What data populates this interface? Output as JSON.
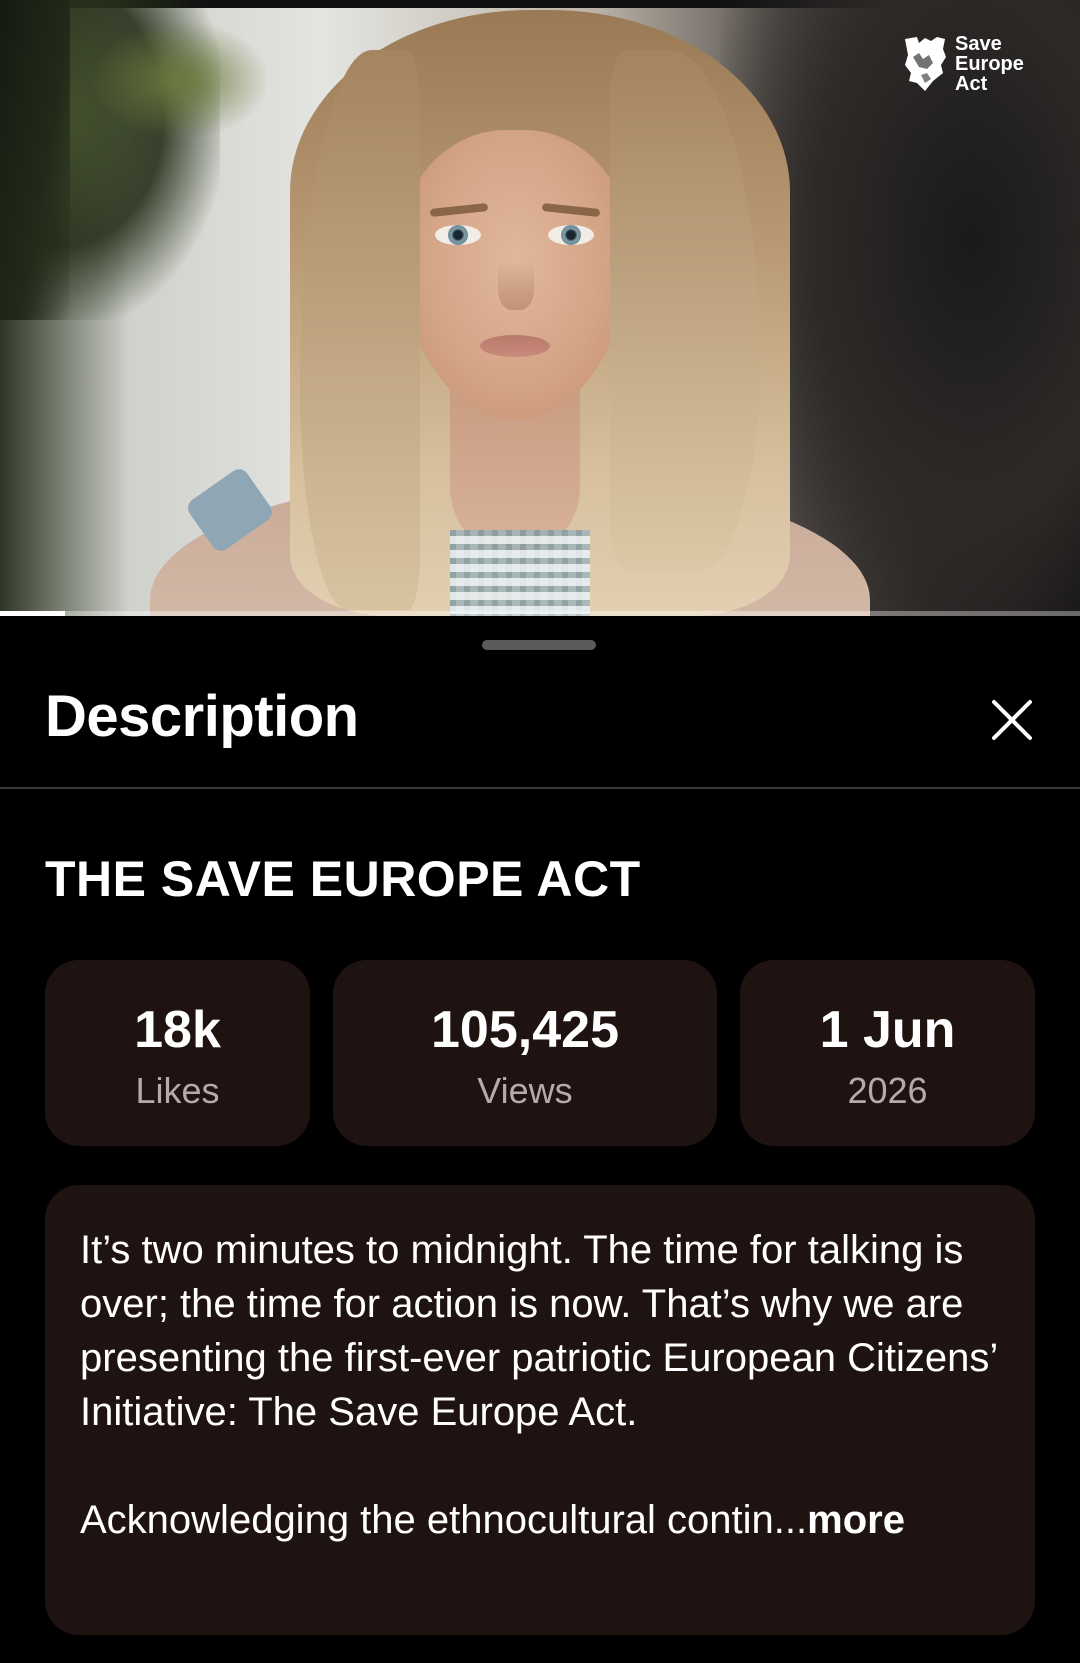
{
  "video": {
    "logo_lines": [
      "Save",
      "Europe",
      "Act"
    ],
    "progress": 0.06
  },
  "sheet": {
    "title": "Description",
    "close_icon": "close-icon"
  },
  "video_title": "THE SAVE EUROPE ACT",
  "stats": {
    "likes": {
      "value": "18k",
      "label": "Likes"
    },
    "views": {
      "value": "105,425",
      "label": "Views"
    },
    "date": {
      "value": "1 Jun",
      "label": "2026"
    }
  },
  "description": {
    "paragraph1": "It’s two minutes to midnight. The time for talking is over; the time for action is now. That’s why we are presenting the first-ever patriotic European Citizens’ Initiative: The Save Europe Act.",
    "paragraph2": "Acknowledging the ethnocultural contin...",
    "more_label": "more"
  },
  "colors": {
    "background": "#000000",
    "card": "#1f1311",
    "muted_text": "#b4abaa"
  }
}
